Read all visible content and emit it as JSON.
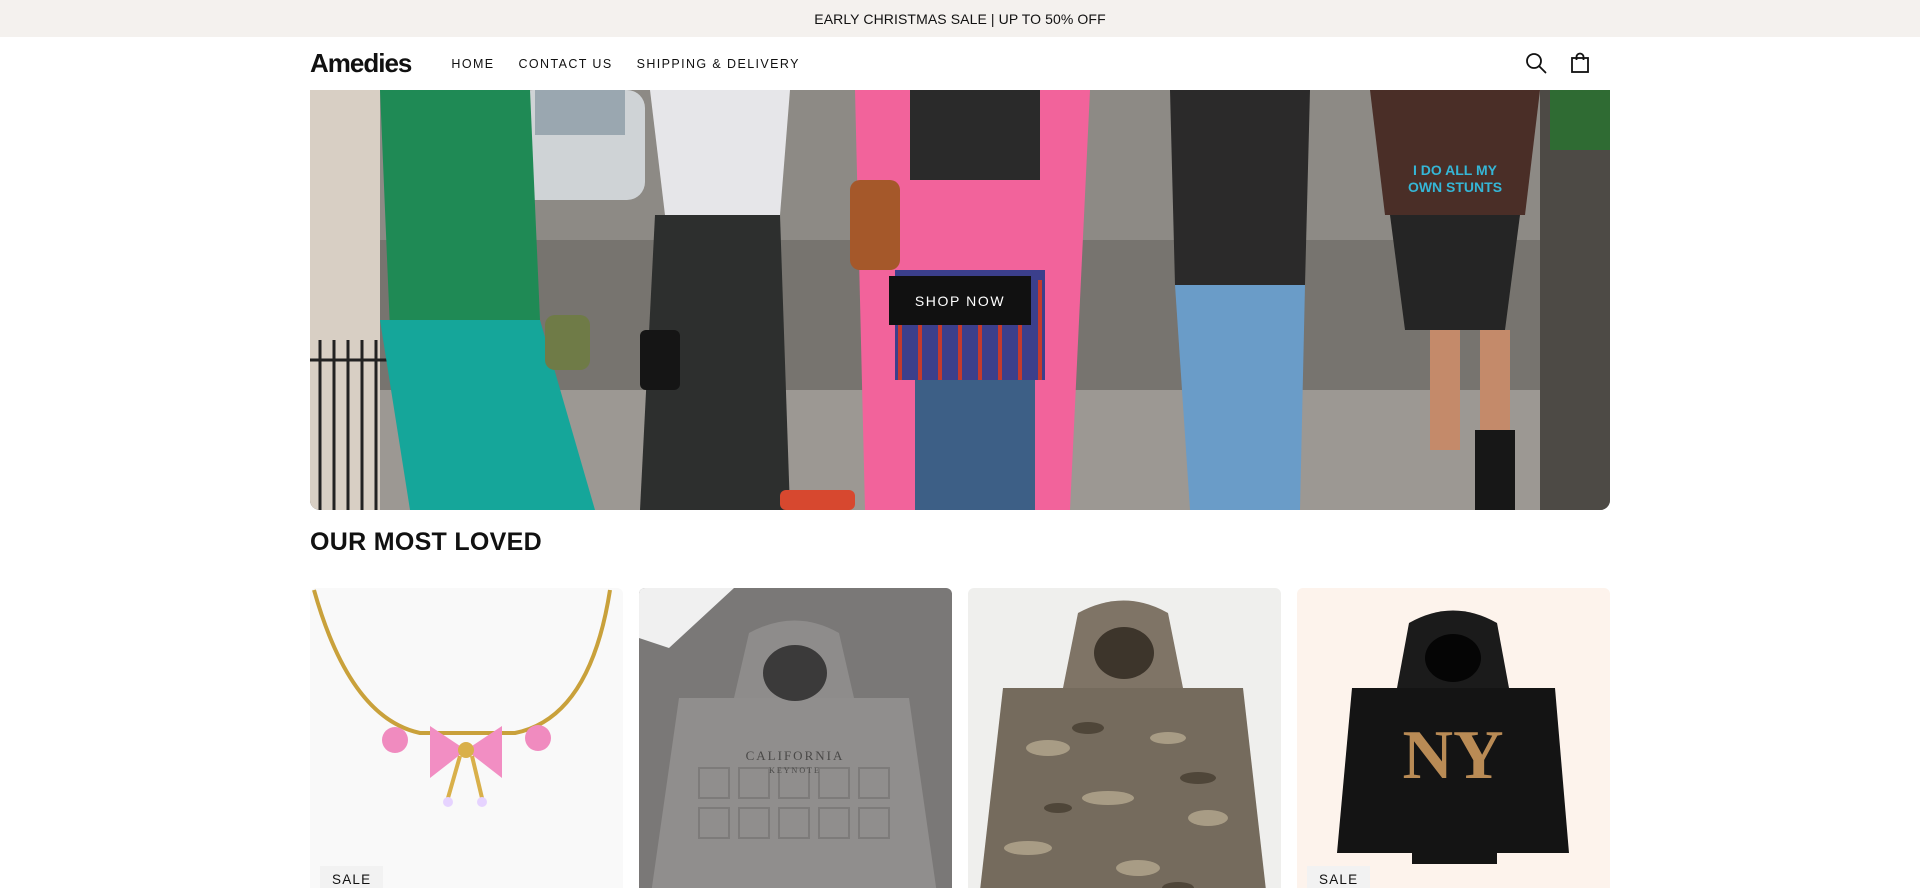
{
  "announcement": {
    "text": "EARLY CHRISTMAS SALE | UP TO 50% OFF"
  },
  "header": {
    "logo": "Amedies",
    "nav": [
      {
        "label": "HOME"
      },
      {
        "label": "CONTACT US"
      },
      {
        "label": "SHIPPING & DELIVERY"
      }
    ],
    "icons": [
      "search-icon",
      "shopping-bag-icon"
    ]
  },
  "hero": {
    "cta_label": "SHOP NOW",
    "photo_text": "I DO ALL MY OWN STUNTS"
  },
  "section": {
    "title": "OUR MOST LOVED"
  },
  "products": [
    {
      "badge": "SALE",
      "image": "pink bow necklace"
    },
    {
      "badge": "",
      "image": "grey California hoodie",
      "print_text": "CALIFORNIA",
      "print_subtext": "KEYNOTE"
    },
    {
      "badge": "",
      "image": "camouflage hoodie"
    },
    {
      "badge": "SALE",
      "image": "black NY hoodie",
      "print_text": "NY"
    }
  ],
  "colors": {
    "announcement_bg": "#f4f1ee",
    "cta_bg": "#111111",
    "badge_bg": "#f2f2f2"
  }
}
